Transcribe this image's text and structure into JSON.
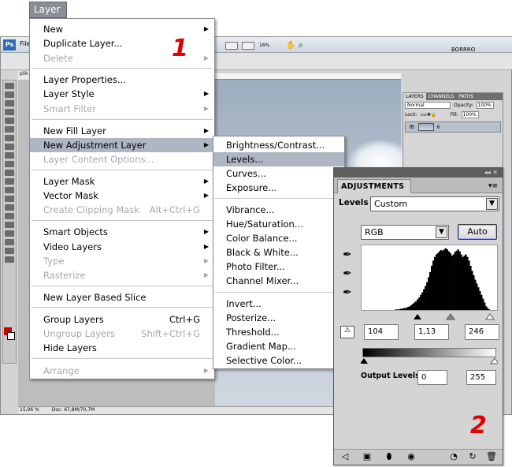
{
  "menubar": {
    "layer_label": "Layer"
  },
  "background_window": {
    "logo": "Ps",
    "file_menu": "File",
    "zoom_value": "16%",
    "brand": "BORRRO",
    "doc_tab": "plik",
    "status_zoom": "15,96 %",
    "status_doc": "Doc: 67,8M/70,7M",
    "layers_panel": {
      "tabs": [
        "LAYERS",
        "CHANNELS",
        "PATHS"
      ],
      "blend_mode": "Normal",
      "opacity_label": "Opacity:",
      "opacity_value": "100%",
      "lock_label": "Lock:",
      "fill_label": "Fill:",
      "fill_value": "100%",
      "layer_name": "6"
    }
  },
  "layer_menu": {
    "items": [
      {
        "label": "New",
        "submenu": true,
        "disabled": false
      },
      {
        "label": "Duplicate Layer...",
        "disabled": false
      },
      {
        "label": "Delete",
        "submenu": true,
        "disabled": true
      },
      {
        "label": "Layer Properties...",
        "disabled": false
      },
      {
        "label": "Layer Style",
        "submenu": true,
        "disabled": false
      },
      {
        "label": "Smart Filter",
        "submenu": true,
        "disabled": true
      },
      {
        "label": "New Fill Layer",
        "submenu": true,
        "disabled": false
      },
      {
        "label": "New Adjustment Layer",
        "submenu": true,
        "disabled": false,
        "highlighted": true
      },
      {
        "label": "Layer Content Options...",
        "disabled": true
      },
      {
        "label": "Layer Mask",
        "submenu": true,
        "disabled": false
      },
      {
        "label": "Vector Mask",
        "submenu": true,
        "disabled": false
      },
      {
        "label": "Create Clipping Mask",
        "shortcut": "Alt+Ctrl+G",
        "disabled": true
      },
      {
        "label": "Smart Objects",
        "submenu": true,
        "disabled": false
      },
      {
        "label": "Video Layers",
        "submenu": true,
        "disabled": false
      },
      {
        "label": "Type",
        "submenu": true,
        "disabled": true
      },
      {
        "label": "Rasterize",
        "submenu": true,
        "disabled": true
      },
      {
        "label": "New Layer Based Slice",
        "disabled": false
      },
      {
        "label": "Group Layers",
        "shortcut": "Ctrl+G",
        "disabled": false
      },
      {
        "label": "Ungroup Layers",
        "shortcut": "Shift+Ctrl+G",
        "disabled": true
      },
      {
        "label": "Hide Layers",
        "disabled": false
      },
      {
        "label": "Arrange",
        "submenu": true,
        "disabled": true
      }
    ]
  },
  "annotation_1": "1",
  "annotation_2": "2",
  "adjustment_submenu": {
    "items": [
      "Brightness/Contrast...",
      "Levels...",
      "Curves...",
      "Exposure...",
      "Vibrance...",
      "Hue/Saturation...",
      "Color Balance...",
      "Black & White...",
      "Photo Filter...",
      "Channel Mixer...",
      "Invert...",
      "Posterize...",
      "Threshold...",
      "Gradient Map...",
      "Selective Color..."
    ],
    "highlighted": "Levels..."
  },
  "adjustments_panel": {
    "tab_label": "ADJUSTMENTS",
    "levels_label": "Levels",
    "preset_value": "Custom",
    "channel_value": "RGB",
    "auto_label": "Auto",
    "input_black": "104",
    "input_gamma": "1,13",
    "input_white": "246",
    "output_label": "Output Levels:",
    "output_black": "0",
    "output_white": "255",
    "histogram": [
      0,
      0,
      0,
      0,
      0,
      0,
      0,
      0,
      0,
      0,
      0,
      0,
      0,
      0,
      0,
      0,
      0,
      0,
      0,
      0,
      0,
      1,
      1,
      1,
      2,
      2,
      3,
      3,
      4,
      5,
      6,
      8,
      10,
      12,
      14,
      17,
      20,
      24,
      28,
      33,
      38,
      44,
      52,
      60,
      70,
      78,
      84,
      88,
      90,
      93,
      95,
      94,
      96,
      98,
      96,
      93,
      90,
      86,
      88,
      92,
      94,
      96,
      93,
      88,
      84,
      86,
      88,
      84,
      78,
      70,
      62,
      55,
      48,
      42,
      36,
      30,
      24,
      18,
      12,
      6,
      3,
      1,
      0,
      0,
      0,
      0
    ]
  }
}
